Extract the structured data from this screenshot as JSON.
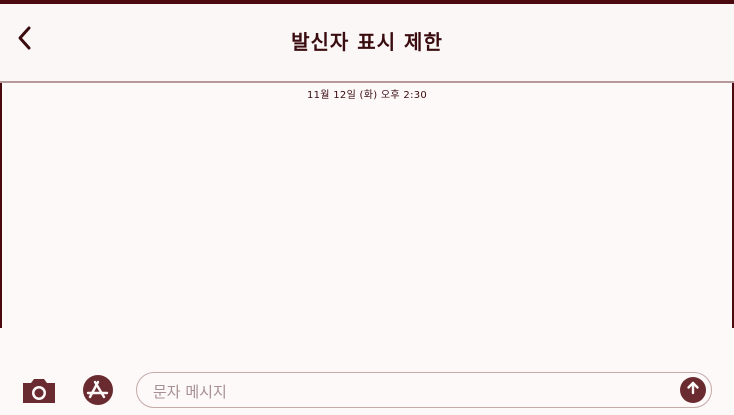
{
  "nav": {
    "back_icon": "chevron-left-icon",
    "title": "발신자 표시 제한"
  },
  "conversation": {
    "timestamp": "11월 12일 (화) 오후 2:30"
  },
  "composer": {
    "camera_icon": "camera-icon",
    "apps_icon": "app-store-icon",
    "placeholder": "문자 메시지",
    "send_icon": "arrow-up-icon"
  },
  "colors": {
    "frame": "#4a0a0f",
    "background": "#fdf9f8",
    "title_text": "#3a0c10",
    "placeholder_text": "#a69091",
    "icon": "#6a2b30"
  }
}
